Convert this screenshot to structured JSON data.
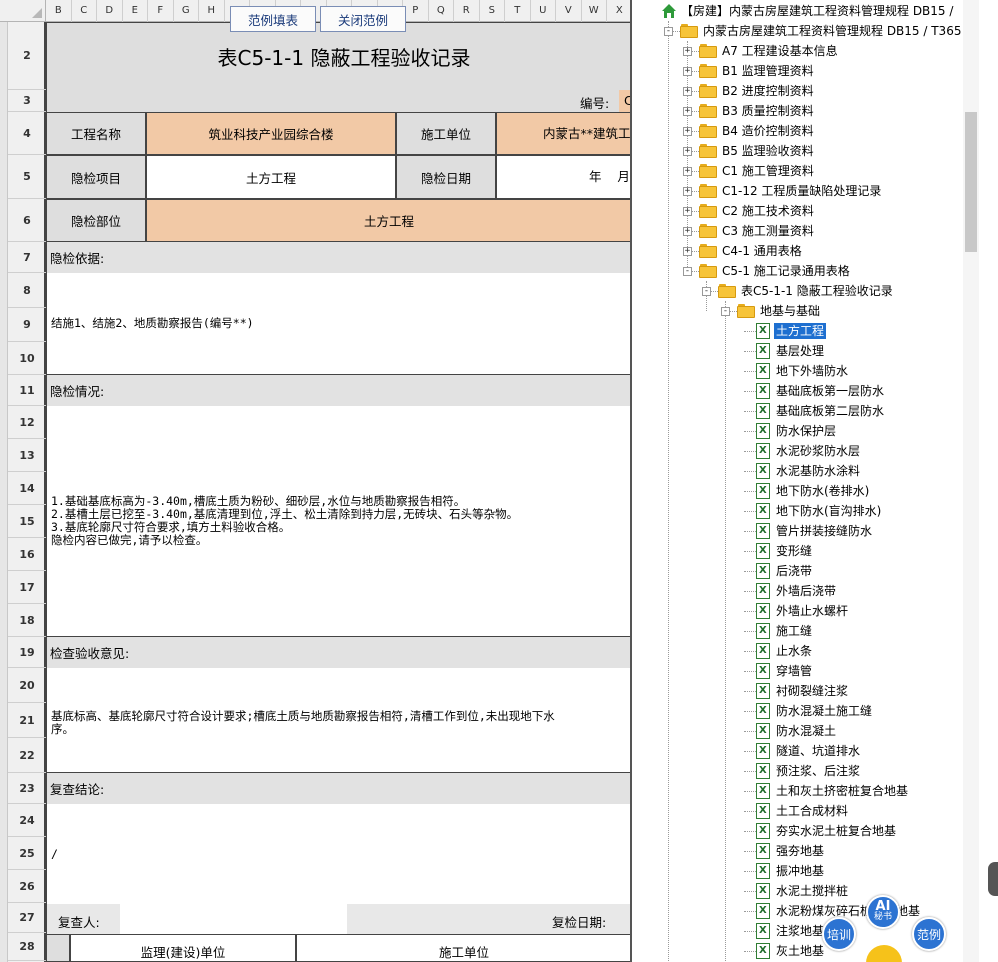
{
  "sheet": {
    "columns": [
      "B",
      "C",
      "D",
      "E",
      "F",
      "G",
      "H",
      "",
      "",
      "",
      "",
      "",
      "",
      "",
      "P",
      "Q",
      "R",
      "S",
      "T",
      "U",
      "V",
      "W",
      "X"
    ],
    "rows": [
      "2",
      "3",
      "4",
      "5",
      "6",
      "7",
      "8",
      "9",
      "10",
      "11",
      "12",
      "13",
      "14",
      "15",
      "16",
      "17",
      "18",
      "19",
      "20",
      "21",
      "22",
      "23",
      "24",
      "25",
      "26",
      "27",
      "28"
    ],
    "buttons": {
      "fill_example": "范例填表",
      "close_example": "关闭范例"
    },
    "title": "表C5-1-1 隐蔽工程验收记录",
    "number_label": "编号:",
    "number_value": "C",
    "project_name_label": "工程名称",
    "project_name_value": "筑业科技产业园综合楼",
    "constructor_label": "施工单位",
    "constructor_value": "内蒙古**建筑工",
    "item_label": "隐检项目",
    "item_value": "土方工程",
    "date_label": "隐检日期",
    "date_value": "年    月",
    "location_label": "隐检部位",
    "location_value": "土方工程",
    "basis_label": "隐检依据:",
    "basis_text": "结施1、结施2、地质勘察报告(编号**)",
    "situation_label": "隐检情况:",
    "situation_lines": [
      "1.基础基底标高为-3.40m,槽底土质为粉砂、细砂层,水位与地质勘察报告相符。",
      "2.基槽土层已挖至-3.40m,基底清理到位,浮土、松土清除到持力层,无砖块、石头等杂物。",
      "3.基底轮廓尺寸符合要求,填方土料验收合格。",
      "隐检内容已做完,请予以检查。"
    ],
    "opinion_label": "检查验收意见:",
    "opinion_lines": [
      "基底标高、基底轮廓尺寸符合设计要求;槽底土质与地质勘察报告相符,清槽工作到位,未出现地下水",
      "序。"
    ],
    "review_label": "复查结论:",
    "review_text": "/",
    "reviewer_label": "复查人:",
    "review_date_label": "复检日期:",
    "supervisor_label": "监理(建设)单位",
    "construction_unit_label": "施工单位"
  },
  "tree": {
    "items": [
      {
        "label": "【房建】内蒙古房屋建筑工程资料管理规程 DB15 /",
        "icon": "home-icon",
        "level": 0,
        "expander": "",
        "selected": false
      },
      {
        "label": "内蒙古房屋建筑工程资料管理规程 DB15 / T365",
        "icon": "folder-open-icon",
        "level": 1,
        "expander": "-",
        "selected": false
      },
      {
        "label": "A7 工程建设基本信息",
        "icon": "folder-icon",
        "level": 2,
        "expander": "+",
        "selected": false
      },
      {
        "label": "B1 监理管理资料",
        "icon": "folder-icon",
        "level": 2,
        "expander": "+",
        "selected": false
      },
      {
        "label": "B2 进度控制资料",
        "icon": "folder-icon",
        "level": 2,
        "expander": "+",
        "selected": false
      },
      {
        "label": "B3 质量控制资料",
        "icon": "folder-icon",
        "level": 2,
        "expander": "+",
        "selected": false
      },
      {
        "label": "B4 造价控制资料",
        "icon": "folder-icon",
        "level": 2,
        "expander": "+",
        "selected": false
      },
      {
        "label": "B5 监理验收资料",
        "icon": "folder-icon",
        "level": 2,
        "expander": "+",
        "selected": false
      },
      {
        "label": "C1 施工管理资料",
        "icon": "folder-icon",
        "level": 2,
        "expander": "+",
        "selected": false
      },
      {
        "label": "C1-12 工程质量缺陷处理记录",
        "icon": "folder-icon",
        "level": 2,
        "expander": "+",
        "selected": false
      },
      {
        "label": "C2 施工技术资料",
        "icon": "folder-icon",
        "level": 2,
        "expander": "+",
        "selected": false
      },
      {
        "label": "C3 施工测量资料",
        "icon": "folder-icon",
        "level": 2,
        "expander": "+",
        "selected": false
      },
      {
        "label": "C4-1 通用表格",
        "icon": "folder-icon",
        "level": 2,
        "expander": "+",
        "selected": false
      },
      {
        "label": "C5-1 施工记录通用表格",
        "icon": "folder-open-icon",
        "level": 2,
        "expander": "-",
        "selected": false
      },
      {
        "label": "表C5-1-1 隐蔽工程验收记录",
        "icon": "folder-open-icon",
        "level": 3,
        "expander": "-",
        "selected": false
      },
      {
        "label": "地基与基础",
        "icon": "folder-open-icon",
        "level": 4,
        "expander": "-",
        "selected": false
      },
      {
        "label": "土方工程",
        "icon": "excel-file-icon",
        "level": 5,
        "expander": "",
        "selected": true
      },
      {
        "label": "基层处理",
        "icon": "excel-file-icon",
        "level": 5,
        "expander": "",
        "selected": false
      },
      {
        "label": "地下外墙防水",
        "icon": "excel-file-icon",
        "level": 5,
        "expander": "",
        "selected": false
      },
      {
        "label": "基础底板第一层防水",
        "icon": "excel-file-icon",
        "level": 5,
        "expander": "",
        "selected": false
      },
      {
        "label": "基础底板第二层防水",
        "icon": "excel-file-icon",
        "level": 5,
        "expander": "",
        "selected": false
      },
      {
        "label": "防水保护层",
        "icon": "excel-file-icon",
        "level": 5,
        "expander": "",
        "selected": false
      },
      {
        "label": "水泥砂浆防水层",
        "icon": "excel-file-icon",
        "level": 5,
        "expander": "",
        "selected": false
      },
      {
        "label": "水泥基防水涂料",
        "icon": "excel-file-icon",
        "level": 5,
        "expander": "",
        "selected": false
      },
      {
        "label": "地下防水(卷排水)",
        "icon": "excel-file-icon",
        "level": 5,
        "expander": "",
        "selected": false
      },
      {
        "label": "地下防水(盲沟排水)",
        "icon": "excel-file-icon",
        "level": 5,
        "expander": "",
        "selected": false
      },
      {
        "label": "管片拼装接缝防水",
        "icon": "excel-file-icon",
        "level": 5,
        "expander": "",
        "selected": false
      },
      {
        "label": "变形缝",
        "icon": "excel-file-icon",
        "level": 5,
        "expander": "",
        "selected": false
      },
      {
        "label": "后浇带",
        "icon": "excel-file-icon",
        "level": 5,
        "expander": "",
        "selected": false
      },
      {
        "label": "外墙后浇带",
        "icon": "excel-file-icon",
        "level": 5,
        "expander": "",
        "selected": false
      },
      {
        "label": "外墙止水螺杆",
        "icon": "excel-file-icon",
        "level": 5,
        "expander": "",
        "selected": false
      },
      {
        "label": "施工缝",
        "icon": "excel-file-icon",
        "level": 5,
        "expander": "",
        "selected": false
      },
      {
        "label": "止水条",
        "icon": "excel-file-icon",
        "level": 5,
        "expander": "",
        "selected": false
      },
      {
        "label": "穿墙管",
        "icon": "excel-file-icon",
        "level": 5,
        "expander": "",
        "selected": false
      },
      {
        "label": "衬砌裂缝注浆",
        "icon": "excel-file-icon",
        "level": 5,
        "expander": "",
        "selected": false
      },
      {
        "label": "防水混凝土施工缝",
        "icon": "excel-file-icon",
        "level": 5,
        "expander": "",
        "selected": false
      },
      {
        "label": "防水混凝土",
        "icon": "excel-file-icon",
        "level": 5,
        "expander": "",
        "selected": false
      },
      {
        "label": "隧道、坑道排水",
        "icon": "excel-file-icon",
        "level": 5,
        "expander": "",
        "selected": false
      },
      {
        "label": "预注浆、后注浆",
        "icon": "excel-file-icon",
        "level": 5,
        "expander": "",
        "selected": false
      },
      {
        "label": "土和灰土挤密桩复合地基",
        "icon": "excel-file-icon",
        "level": 5,
        "expander": "",
        "selected": false
      },
      {
        "label": "土工合成材料",
        "icon": "excel-file-icon",
        "level": 5,
        "expander": "",
        "selected": false
      },
      {
        "label": "夯实水泥土桩复合地基",
        "icon": "excel-file-icon",
        "level": 5,
        "expander": "",
        "selected": false
      },
      {
        "label": "强夯地基",
        "icon": "excel-file-icon",
        "level": 5,
        "expander": "",
        "selected": false
      },
      {
        "label": "振冲地基",
        "icon": "excel-file-icon",
        "level": 5,
        "expander": "",
        "selected": false
      },
      {
        "label": "水泥土搅拌桩",
        "icon": "excel-file-icon",
        "level": 5,
        "expander": "",
        "selected": false
      },
      {
        "label": "水泥粉煤灰碎石桩复合地基",
        "icon": "excel-file-icon",
        "level": 5,
        "expander": "",
        "selected": false
      },
      {
        "label": "注浆地基",
        "icon": "excel-file-icon",
        "level": 5,
        "expander": "",
        "selected": false
      },
      {
        "label": "灰土地基",
        "icon": "excel-file-icon",
        "level": 5,
        "expander": "",
        "selected": false
      }
    ]
  },
  "floating": {
    "ai_label": "AI",
    "ai_sub": "秘书",
    "train_label": "培训",
    "example_label": "范例"
  },
  "colors": {
    "peach": "#f2c9a6",
    "gray": "#dedede",
    "accent": "#2c73d2",
    "selection": "#1e6fd0"
  }
}
